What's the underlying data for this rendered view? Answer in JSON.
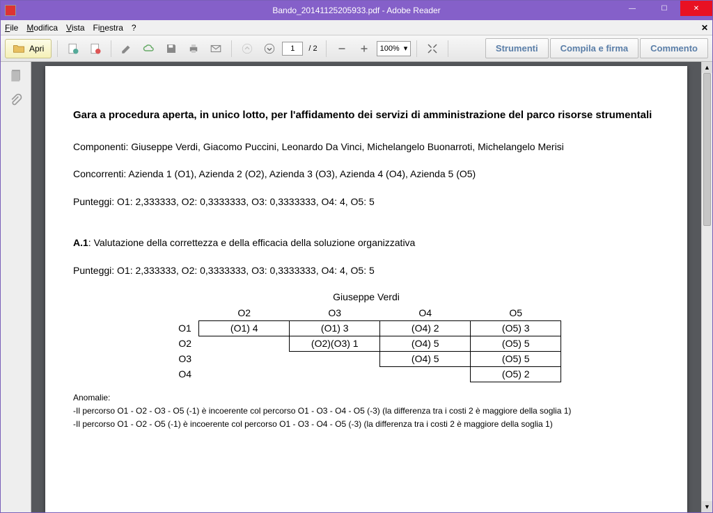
{
  "window": {
    "title": "Bando_20141125205933.pdf - Adobe Reader"
  },
  "menu": {
    "file": "File",
    "modifica": "Modifica",
    "vista": "Vista",
    "finestra": "Finestra",
    "help": "?"
  },
  "toolbar": {
    "open": "Apri",
    "page": "1",
    "page_of": "/ 2",
    "zoom": "100%",
    "strumenti": "Strumenti",
    "compila": "Compila e firma",
    "commento": "Commento"
  },
  "doc": {
    "title": "Gara a procedura aperta, in unico lotto, per l'affidamento dei servizi di amministrazione del parco risorse strumentali",
    "componenti": "Componenti: Giuseppe Verdi, Giacomo Puccini, Leonardo Da Vinci, Michelangelo Buonarroti, Michelangelo Merisi",
    "concorrenti": "Concorrenti: Azienda 1 (O1), Azienda 2 (O2), Azienda 3 (O3), Azienda 4 (O4), Azienda 5 (O5)",
    "punteggi1": "Punteggi: O1: 2,333333, O2: 0,3333333, O3: 0,3333333, O4: 4, O5: 5",
    "a1_id": "A.1",
    "a1_desc": ": Valutazione della correttezza e della efficacia della soluzione organizzativa",
    "punteggi2": "Punteggi: O1: 2,333333, O2: 0,3333333, O3: 0,3333333, O4: 4, O5: 5",
    "matrix": {
      "judge": "Giuseppe Verdi",
      "cols": [
        "O2",
        "O3",
        "O4",
        "O5"
      ],
      "rows": [
        "O1",
        "O2",
        "O3",
        "O4"
      ],
      "cells": {
        "r0c0": "(O1) 4",
        "r0c1": "(O1) 3",
        "r0c2": "(O4) 2",
        "r0c3": "(O5) 3",
        "r1c1": "(O2)(O3) 1",
        "r1c2": "(O4) 5",
        "r1c3": "(O5) 5",
        "r2c2": "(O4) 5",
        "r2c3": "(O5) 5",
        "r3c3": "(O5) 2"
      }
    },
    "anom_label": "Anomalie:",
    "anom1": "-Il percorso O1 - O2 - O3 - O5 (-1) è incoerente col percorso O1 - O3 - O4 - O5 (-3) (la differenza tra i costi 2 è maggiore della soglia 1)",
    "anom2": "-Il percorso O1 - O2 - O5 (-1) è incoerente col percorso O1 - O3 - O4 - O5 (-3) (la differenza tra i costi 2 è maggiore della soglia 1)"
  }
}
